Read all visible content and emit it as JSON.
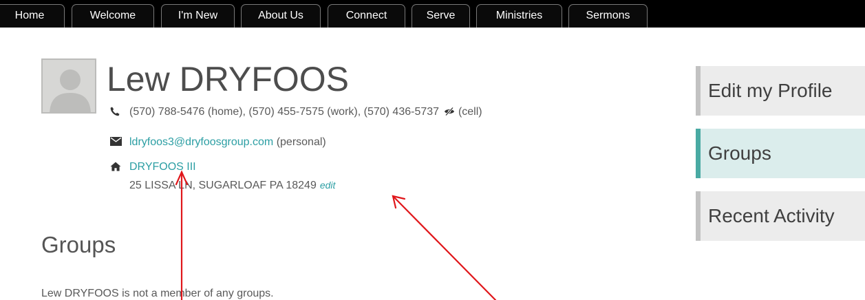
{
  "nav": {
    "tabs": [
      {
        "label": "Home"
      },
      {
        "label": "Welcome"
      },
      {
        "label": "I'm New"
      },
      {
        "label": "About Us"
      },
      {
        "label": "Connect"
      },
      {
        "label": "Serve"
      },
      {
        "label": "Ministries"
      },
      {
        "label": "Sermons"
      }
    ]
  },
  "profile": {
    "name": "Lew DRYFOOS",
    "phones": {
      "main": "(570) 788-5476 (home), (570) 455-7575 (work), (570) 436-5737",
      "cell_suffix": "(cell)"
    },
    "email": {
      "address": "ldryfoos3@dryfoosgroup.com",
      "type": "(personal)"
    },
    "family": {
      "name": "DRYFOOS III",
      "address": "25 LISSA LN, SUGARLOAF PA 18249",
      "edit_label": "edit"
    }
  },
  "groups": {
    "heading": "Groups",
    "empty_text": "Lew DRYFOOS is not a member of any groups."
  },
  "sidebar": {
    "items": [
      {
        "label": "Edit my Profile"
      },
      {
        "label": "Groups"
      },
      {
        "label": "Recent Activity"
      }
    ],
    "active_color": "#49aaa3"
  },
  "icons": {
    "phone": "phone-icon",
    "email": "envelope-icon",
    "home": "home-icon",
    "hidden": "eye-slash-icon"
  },
  "colors": {
    "link": "#2b9ea3",
    "annotation": "#e0161a"
  }
}
